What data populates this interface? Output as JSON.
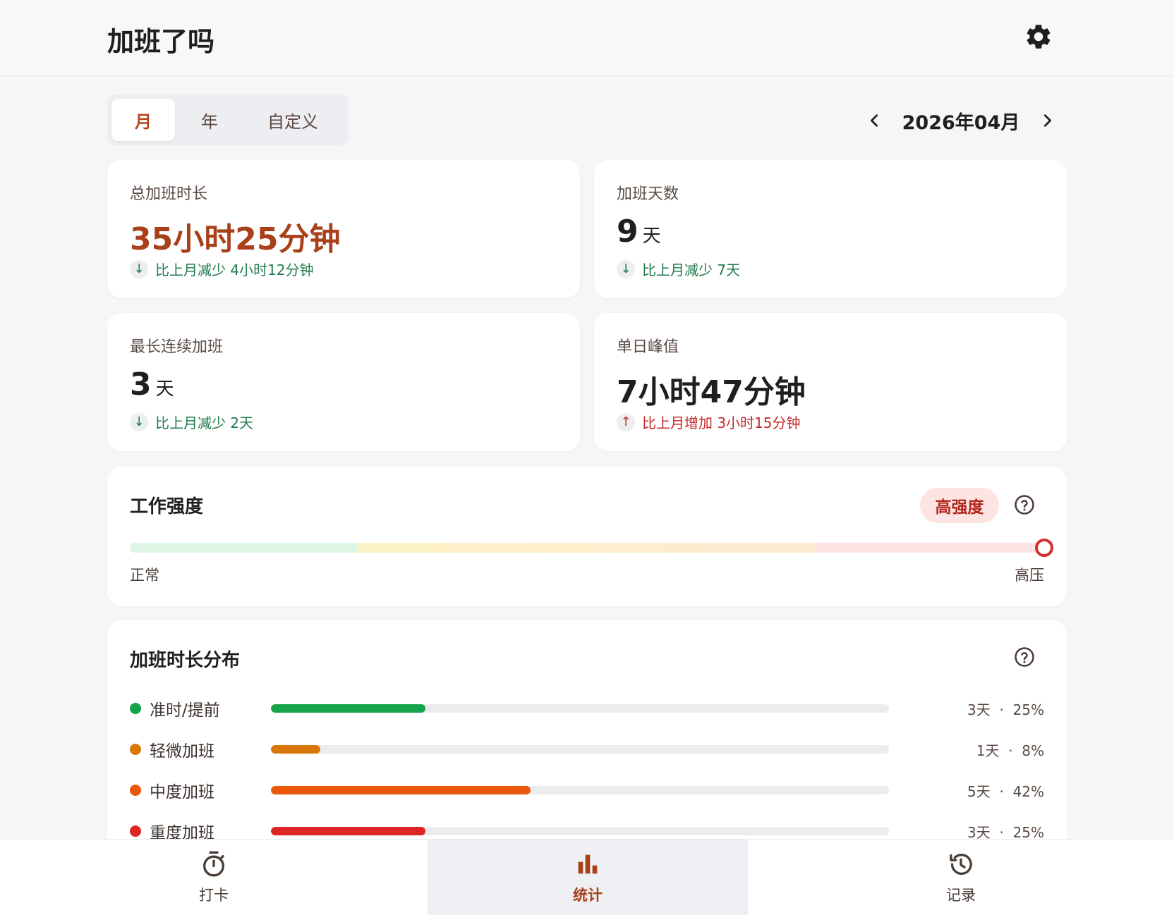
{
  "header": {
    "title": "加班了吗",
    "settings_icon": "gear-icon"
  },
  "period_tabs": {
    "selected": "月",
    "items": [
      {
        "label": "月"
      },
      {
        "label": "年"
      },
      {
        "label": "自定义"
      }
    ]
  },
  "month_nav": {
    "label": "2026年04月",
    "prev_icon": "chevron-left-icon",
    "next_icon": "chevron-right-icon"
  },
  "stats": {
    "total_duration": {
      "label": "总加班时长",
      "value": "35小时25分钟",
      "compare_icon": "↓",
      "compare": "比上月减少 4小时12分钟",
      "trend": "down"
    },
    "overtime_days": {
      "label": "加班天数",
      "value": "9",
      "unit": "天",
      "compare_icon": "↓",
      "compare": "比上月减少 7天",
      "trend": "down"
    },
    "longest_streak": {
      "label": "最长连续加班",
      "value": "3",
      "unit": "天",
      "compare_icon": "↓",
      "compare": "比上月减少 2天",
      "trend": "down"
    },
    "daily_peak": {
      "label": "单日峰值",
      "value": "7小时47分钟",
      "compare_icon": "↑",
      "compare": "比上月增加 3小时15分钟",
      "trend": "up"
    }
  },
  "intensity": {
    "title": "工作强度",
    "badge": "高强度",
    "level": 1.0,
    "scale_low": "正常",
    "scale_high": "高压",
    "colors": {
      "normal": "#ddf6e6",
      "light": "#fdf2c6",
      "moderate": "#fdebd3",
      "high": "#fde3e3",
      "marker": "#d32f2f"
    }
  },
  "distribution": {
    "title": "加班时长分布",
    "rows": [
      {
        "label": "准时/提前",
        "days": "3天",
        "sep": "·",
        "percent": "25%",
        "fraction": 0.25,
        "color": "#16a34a"
      },
      {
        "label": "轻微加班",
        "days": "1天",
        "sep": "·",
        "percent": "8%",
        "fraction": 0.08,
        "color": "#d97706"
      },
      {
        "label": "中度加班",
        "days": "5天",
        "sep": "·",
        "percent": "42%",
        "fraction": 0.42,
        "color": "#ea580c"
      },
      {
        "label": "重度加班",
        "days": "3天",
        "sep": "·",
        "percent": "25%",
        "fraction": 0.25,
        "color": "#dc2626"
      }
    ]
  },
  "bottom_nav": {
    "active": "统计",
    "items": [
      {
        "label": "打卡",
        "icon": "stopwatch-icon"
      },
      {
        "label": "统计",
        "icon": "bar-chart-icon"
      },
      {
        "label": "记录",
        "icon": "history-icon"
      }
    ]
  }
}
